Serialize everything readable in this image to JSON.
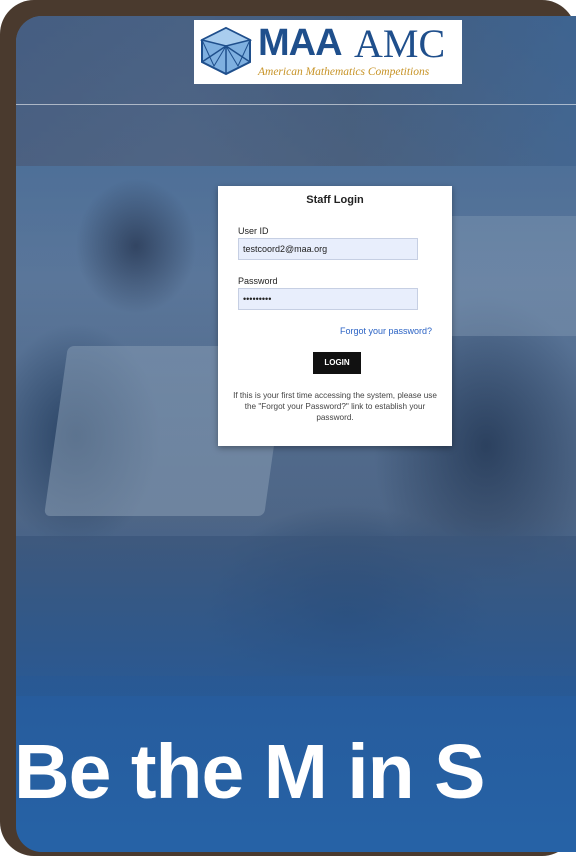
{
  "logo": {
    "wordmark_left": "MAA",
    "wordmark_right": "AMC",
    "subtitle": "American Mathematics Competitions",
    "icon": "icosahedron-logo-icon"
  },
  "login": {
    "title": "Staff Login",
    "user_id_label": "User ID",
    "user_id_value": "testcoord2@maa.org",
    "password_label": "Password",
    "password_value": "•••••••••",
    "forgot_link": "Forgot your password?",
    "login_button": "LOGIN",
    "note": "If this is your first time accessing the system, please use the \"Forgot your Password?\" link to establish your password."
  },
  "banner": {
    "text": "Be the M in S"
  },
  "colors": {
    "brand_blue": "#1f4f8c",
    "brand_gold": "#c79326",
    "overlay_blue": "#2c60a0",
    "link_blue": "#2a62c4",
    "frame_brown": "#4a3a2e"
  }
}
